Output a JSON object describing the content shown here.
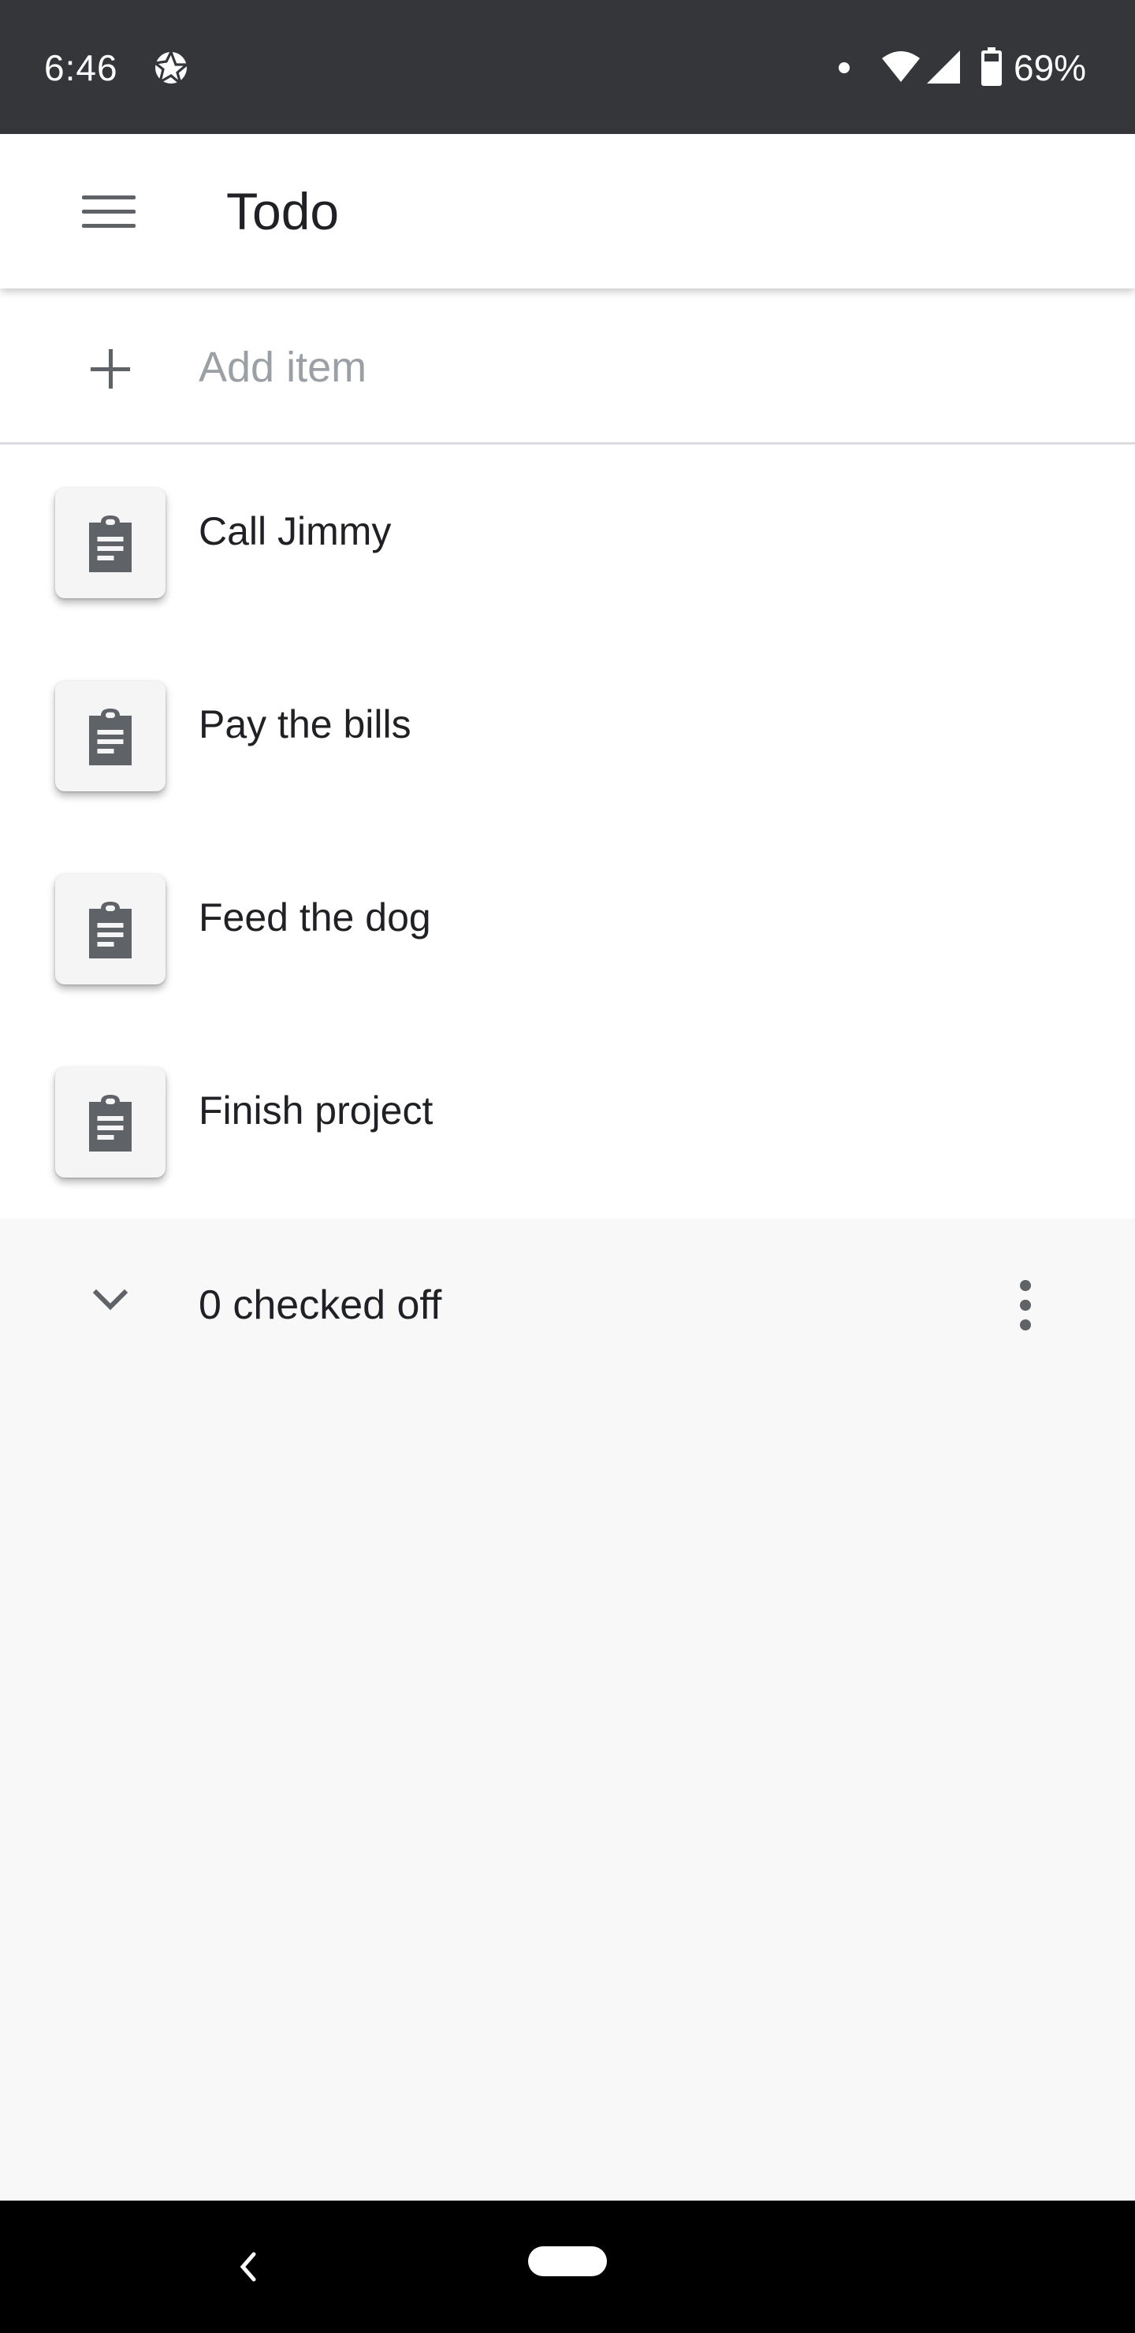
{
  "status_bar": {
    "time": "6:46",
    "battery_percent": "69%",
    "icons": [
      "aperture-icon",
      "notification-dot-icon",
      "wifi-icon",
      "cell-signal-icon",
      "battery-icon"
    ]
  },
  "app_bar": {
    "title": "Todo",
    "menu_icon": "menu-icon"
  },
  "add_item": {
    "placeholder": "Add item",
    "value": "",
    "icon": "plus-icon"
  },
  "items": [
    {
      "label": "Call Jimmy",
      "icon": "clipboard-icon"
    },
    {
      "label": "Pay the bills",
      "icon": "clipboard-icon"
    },
    {
      "label": "Feed the dog",
      "icon": "clipboard-icon"
    },
    {
      "label": "Finish project",
      "icon": "clipboard-icon"
    }
  ],
  "checked_section": {
    "label": "0 checked off",
    "expand_icon": "chevron-down-icon",
    "more_icon": "more-vert-icon"
  },
  "nav_bar": {
    "icons": [
      "back-icon",
      "home-pill-icon"
    ]
  },
  "colors": {
    "status_bar_bg": "#35363a",
    "app_bar_bg": "#ffffff",
    "list_bg": "#ffffff",
    "screen_bg": "#f8f8f8",
    "icon_gray": "#5f6368",
    "text_primary": "#202124",
    "placeholder": "#9aa0a6"
  }
}
